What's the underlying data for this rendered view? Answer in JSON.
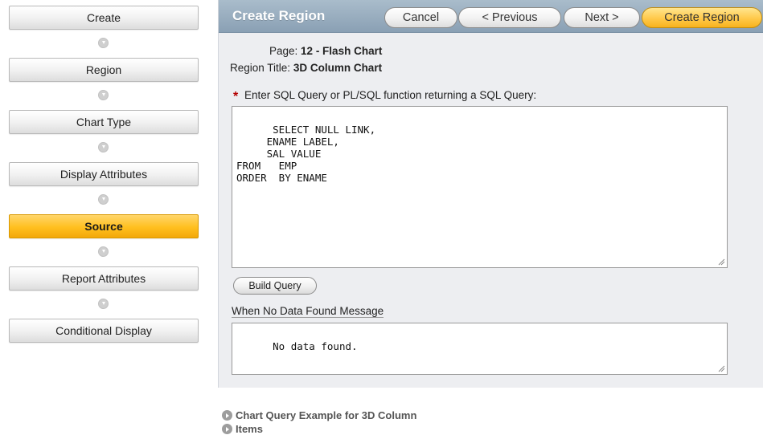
{
  "wizard": {
    "steps": [
      {
        "label": "Create"
      },
      {
        "label": "Region"
      },
      {
        "label": "Chart Type"
      },
      {
        "label": "Display Attributes"
      },
      {
        "label": "Source"
      },
      {
        "label": "Report Attributes"
      },
      {
        "label": "Conditional Display"
      }
    ],
    "current_step": "Source"
  },
  "header": {
    "title": "Create Region",
    "cancel_label": "Cancel",
    "previous_label": "< Previous",
    "next_label": "Next >",
    "create_label": "Create Region"
  },
  "info": {
    "page_label": "Page:",
    "page_value": "12 - Flash Chart",
    "region_title_label": "Region Title:",
    "region_title_value": "3D Column Chart"
  },
  "sql": {
    "required_marker": "*",
    "label": "Enter SQL Query or PL/SQL function returning a SQL Query:",
    "value": "SELECT NULL LINK,\n     ENAME LABEL,\n     SAL VALUE\nFROM   EMP\nORDER  BY ENAME"
  },
  "build_query_label": "Build Query",
  "no_data": {
    "label": "When No Data Found Message",
    "value": "No data found."
  },
  "links": {
    "chart_query_example": "Chart Query Example for 3D Column",
    "items": "Items"
  },
  "colors": {
    "header_bg": "#8aa0b4",
    "panel_bg": "#edeef1",
    "current_step": "#ffbf1f",
    "primary_button": "#ffc94a",
    "required": "#b40000"
  },
  "icons": {
    "step_connector": "chevron-down-icon",
    "link_bullet": "play-circle-icon",
    "textarea_resize": "resize-grip-icon"
  }
}
